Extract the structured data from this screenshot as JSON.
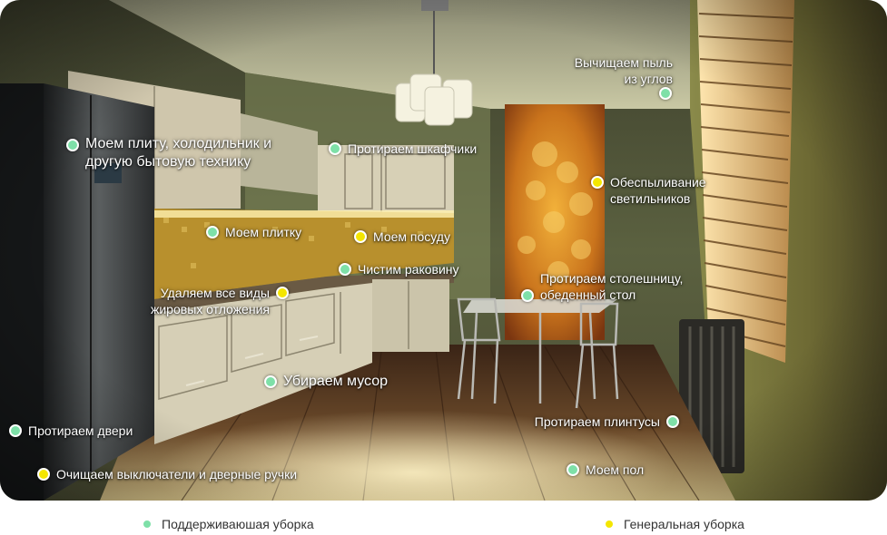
{
  "colors": {
    "maintenance": "#7ee0a8",
    "general": "#f4e600"
  },
  "hotspots": [
    {
      "id": "dust-corners",
      "type": "maintenance",
      "text": "Вычищаем пыль\nиз углов"
    },
    {
      "id": "appliances",
      "type": "maintenance",
      "text": "Моем плиту, холодильник и\nдругую бытовую технику"
    },
    {
      "id": "cabinets",
      "type": "maintenance",
      "text": "Протираем шкафчики"
    },
    {
      "id": "lamps",
      "type": "general",
      "text": "Обеспыливание\nсветильников"
    },
    {
      "id": "tiles",
      "type": "maintenance",
      "text": "Моем плитку"
    },
    {
      "id": "dishes",
      "type": "general",
      "text": "Моем посуду"
    },
    {
      "id": "sink",
      "type": "maintenance",
      "text": "Чистим раковину"
    },
    {
      "id": "countertop",
      "type": "maintenance",
      "text": "Протираем столешницу,\nобеденный стол"
    },
    {
      "id": "grease",
      "type": "general",
      "text": "Удаляем все виды\nжировых отложения"
    },
    {
      "id": "trash",
      "type": "maintenance",
      "text": "Убираем мусор"
    },
    {
      "id": "doors",
      "type": "maintenance",
      "text": "Протираем двери"
    },
    {
      "id": "baseboards",
      "type": "maintenance",
      "text": "Протираем плинтусы"
    },
    {
      "id": "switches",
      "type": "general",
      "text": "Очищаем выключатели и дверные ручки"
    },
    {
      "id": "floor",
      "type": "maintenance",
      "text": "Моем пол"
    }
  ],
  "legend": {
    "maintenance": "Поддерживаюшая уборка",
    "general": "Генеральная уборка"
  }
}
